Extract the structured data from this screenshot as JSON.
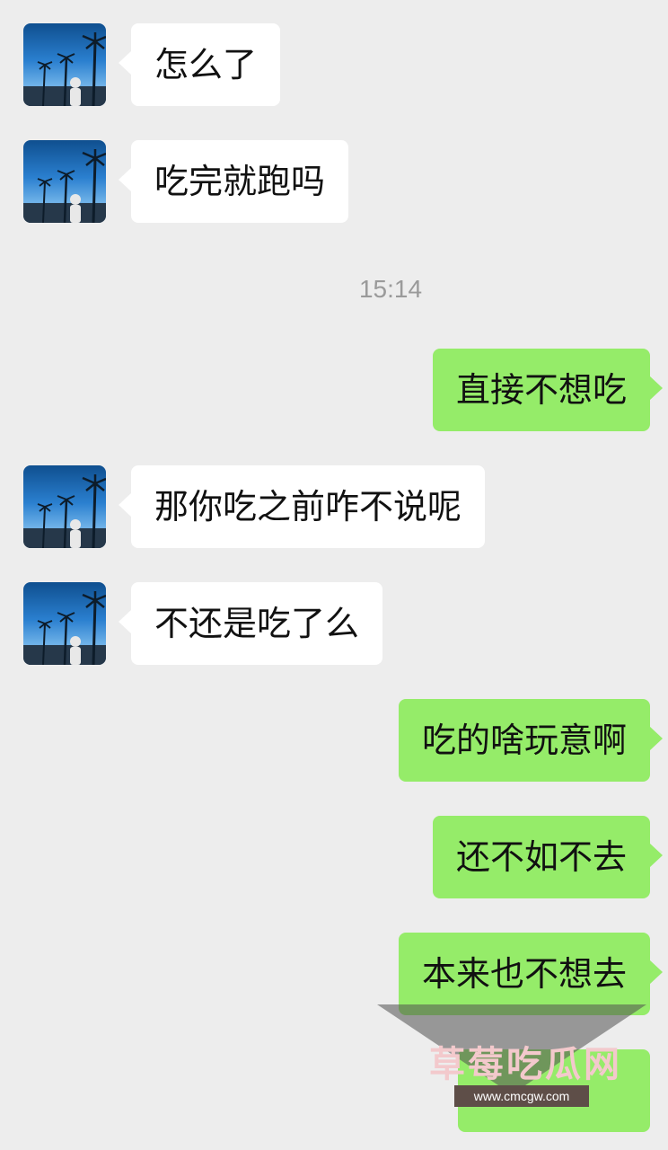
{
  "messages": [
    {
      "side": "in",
      "text": "怎么了"
    },
    {
      "side": "in",
      "text": "吃完就跑吗"
    },
    {
      "side": "time",
      "text": "15:14"
    },
    {
      "side": "out",
      "text": "直接不想吃"
    },
    {
      "side": "in",
      "text": "那你吃之前咋不说呢"
    },
    {
      "side": "in",
      "text": "不还是吃了么"
    },
    {
      "side": "out",
      "text": "吃的啥玩意啊"
    },
    {
      "side": "out",
      "text": "还不如不去"
    },
    {
      "side": "out",
      "text": "本来也不想去"
    }
  ],
  "watermark": {
    "title": "草莓吃瓜网",
    "url": "www.cmcgw.com"
  },
  "avatar": {
    "icon": "palm-trees-avatar-icon"
  },
  "colors": {
    "background": "#ededed",
    "incoming": "#ffffff",
    "outgoing": "#95ec69",
    "timestamp": "#9a9a9a"
  }
}
